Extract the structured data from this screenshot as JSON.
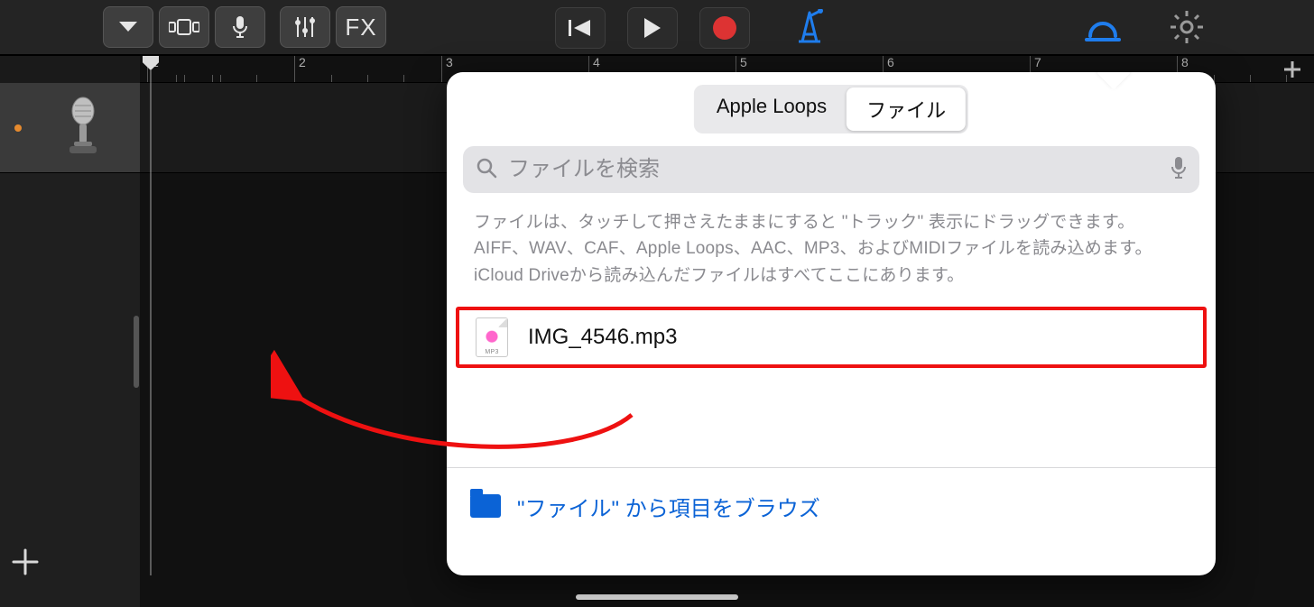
{
  "toolbar": {
    "fx_label": "FX"
  },
  "ruler": {
    "bars": [
      "1",
      "2",
      "3",
      "4",
      "5",
      "6",
      "7",
      "8"
    ]
  },
  "popover": {
    "segments": {
      "loops": "Apple Loops",
      "files": "ファイル"
    },
    "search_placeholder": "ファイルを検索",
    "help_text": "ファイルは、タッチして押さえたままにすると \"トラック\" 表示にドラッグできます。AIFF、WAV、CAF、Apple Loops、AAC、MP3、およびMIDIファイルを読み込めます。iCloud Driveから読み込んだファイルはすべてここにあります。",
    "file_name": "IMG_4546.mp3",
    "browse_label": "\"ファイル\" から項目をブラウズ"
  }
}
